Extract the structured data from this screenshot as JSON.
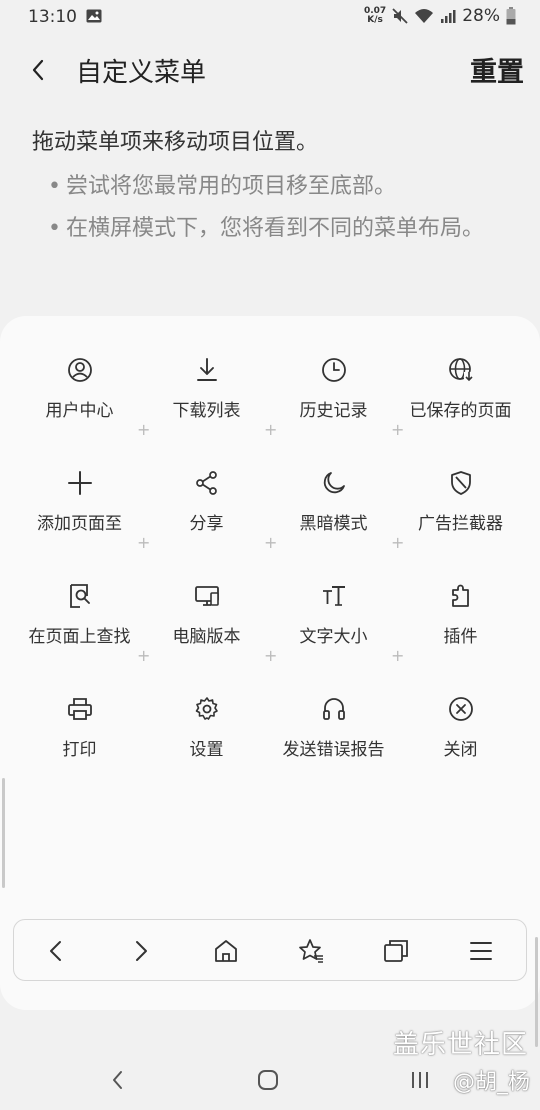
{
  "status_bar": {
    "time": "13:10",
    "net_speed_value": "0.07",
    "net_speed_unit": "K/s",
    "battery": "28%"
  },
  "header": {
    "title": "自定义菜单",
    "reset_label": "重置"
  },
  "instructions": {
    "main": "拖动菜单项来移动项目位置。",
    "tips": [
      "尝试将您最常用的项目移至底部。",
      "在横屏模式下，您将看到不同的菜单布局。"
    ],
    "bullet": "•"
  },
  "menu_items": [
    {
      "label": "用户中心",
      "icon": "user-icon"
    },
    {
      "label": "下载列表",
      "icon": "download-icon"
    },
    {
      "label": "历史记录",
      "icon": "clock-icon"
    },
    {
      "label": "已保存的页面",
      "icon": "globe-download-icon"
    },
    {
      "label": "添加页面至",
      "icon": "plus-icon"
    },
    {
      "label": "分享",
      "icon": "share-icon"
    },
    {
      "label": "黑暗模式",
      "icon": "moon-icon"
    },
    {
      "label": "广告拦截器",
      "icon": "shield-icon"
    },
    {
      "label": "在页面上查找",
      "icon": "find-icon"
    },
    {
      "label": "电脑版本",
      "icon": "desktop-icon"
    },
    {
      "label": "文字大小",
      "icon": "text-size-icon"
    },
    {
      "label": "插件",
      "icon": "puzzle-icon"
    },
    {
      "label": "打印",
      "icon": "print-icon"
    },
    {
      "label": "设置",
      "icon": "gear-icon"
    },
    {
      "label": "发送错误报告",
      "icon": "headset-icon"
    },
    {
      "label": "关闭",
      "icon": "close-circle-icon"
    }
  ],
  "toolbar": [
    "back-icon",
    "forward-icon",
    "home-icon",
    "bookmark-star-icon",
    "tabs-icon",
    "menu-icon"
  ],
  "watermark": {
    "line1": "盖乐世社区",
    "line2": "@胡_杨"
  }
}
